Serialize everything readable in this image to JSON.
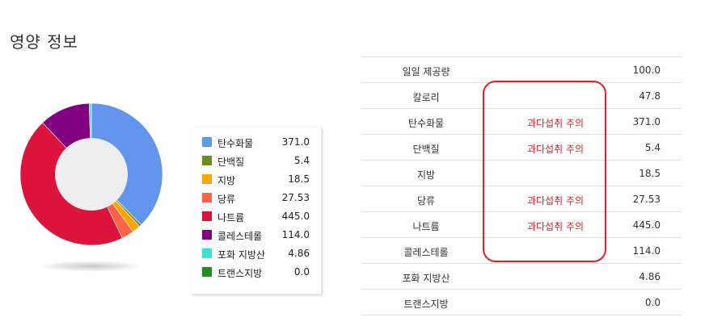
{
  "title": "영양 정보",
  "colors": {
    "carb": "#6495ed",
    "protein": "#6b8e23",
    "fat": "#ffa500",
    "sugar": "#ff6347",
    "sodium": "#dc143c",
    "cholesterol": "#800080",
    "satfat": "#40e0d0",
    "transfat": "#228b22",
    "warning": "#e02020"
  },
  "chart_data": {
    "type": "pie",
    "categories": [
      "탄수화물",
      "단백질",
      "지방",
      "당류",
      "나트륨",
      "콜레스테롤",
      "포화 지방산",
      "트랜스지방"
    ],
    "values": [
      371.0,
      5.4,
      18.5,
      27.53,
      445.0,
      114.0,
      4.86,
      0.0
    ],
    "value_labels": [
      "371.0",
      "5.4",
      "18.5",
      "27.53",
      "445.0",
      "114.0",
      "4.86",
      "0.0"
    ],
    "colors": [
      "#6495ed",
      "#6b8e23",
      "#ffa500",
      "#ff6347",
      "#dc143c",
      "#800080",
      "#40e0d0",
      "#228b22"
    ],
    "legend_placement": "right"
  },
  "table": {
    "rows": [
      {
        "name": "일일 제공량",
        "warning": "",
        "value": "100.0"
      },
      {
        "name": "칼로리",
        "warning": "",
        "value": "47.8"
      },
      {
        "name": "탄수화물",
        "warning": "과다섭취 주의",
        "value": "371.0"
      },
      {
        "name": "단백질",
        "warning": "과다섭취 주의",
        "value": "5.4"
      },
      {
        "name": "지방",
        "warning": "",
        "value": "18.5"
      },
      {
        "name": "당류",
        "warning": "과다섭취 주의",
        "value": "27.53"
      },
      {
        "name": "나트륨",
        "warning": "과다섭취 주의",
        "value": "445.0"
      },
      {
        "name": "콜레스테롤",
        "warning": "",
        "value": "114.0"
      },
      {
        "name": "포화 지방산",
        "warning": "",
        "value": "4.86"
      },
      {
        "name": "트랜스지방",
        "warning": "",
        "value": "0.0"
      }
    ]
  }
}
